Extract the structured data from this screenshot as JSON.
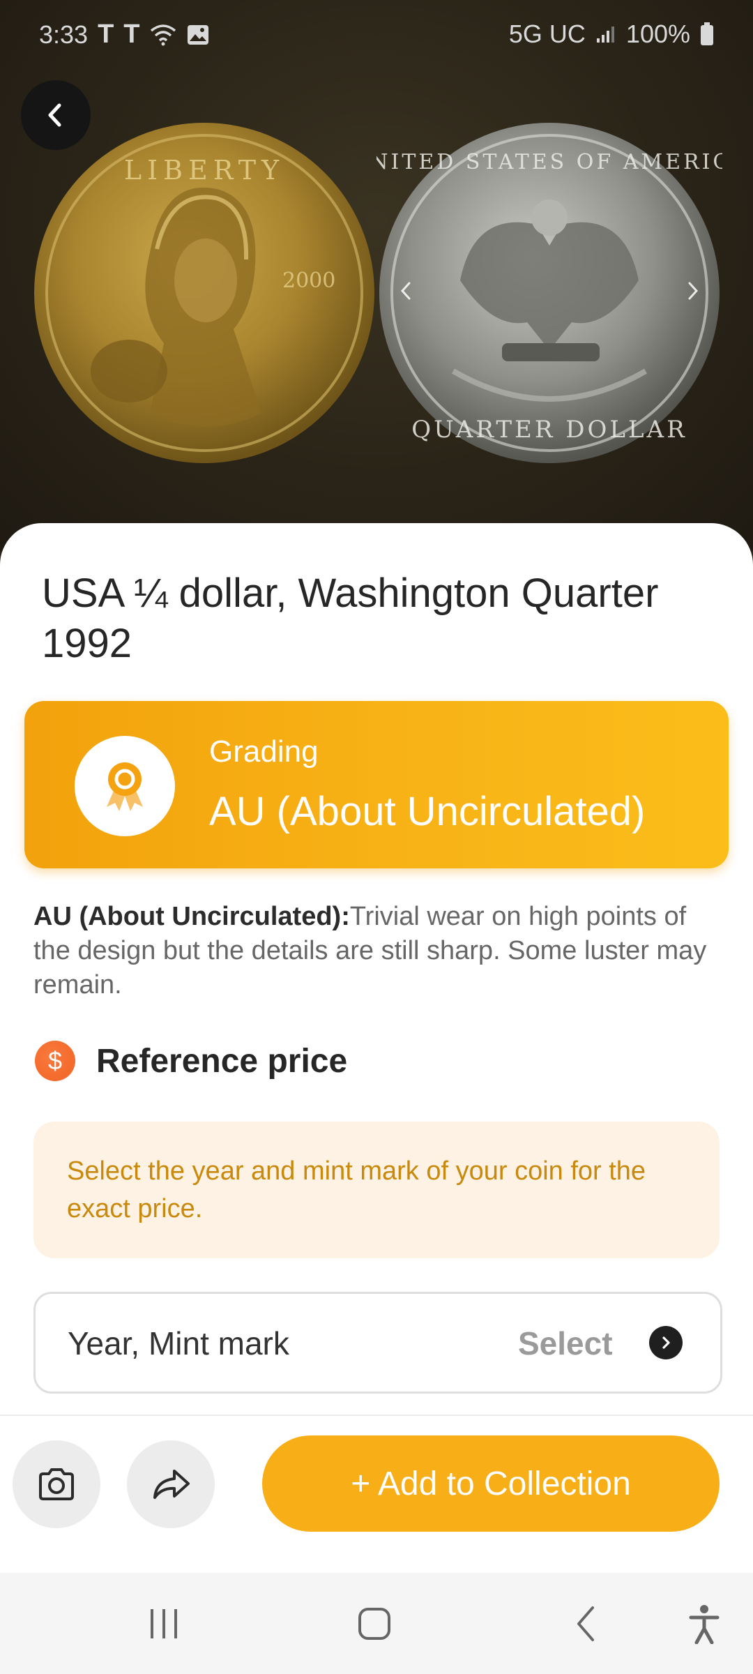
{
  "status_bar": {
    "time": "3:33",
    "carrier_1": "T",
    "carrier_2": "T",
    "network": "5G UC",
    "battery": "100%"
  },
  "coin": {
    "title": "USA ¼ dollar, Washington Quarter 1992",
    "images": [
      "coin-obverse-image",
      "coin-reverse-image"
    ]
  },
  "grading": {
    "label": "Grading",
    "value": "AU (About Uncirculated)",
    "desc_term": "AU (About Uncirculated):",
    "desc_text": "Trivial wear on high points of the design but the details are still sharp. Some luster may remain."
  },
  "reference_price": {
    "title": "Reference price",
    "icon_glyph": "$",
    "hint": "Select the year and mint mark of your coin for the exact price."
  },
  "year_mint": {
    "label": "Year, Mint mark",
    "action": "Select"
  },
  "actions": {
    "add_to_collection": "+ Add to Collection"
  },
  "colors": {
    "accent": "#F7AE17",
    "hint_bg": "#FEF2E4",
    "hint_text": "#C9890C",
    "price_icon": "#F36A2C"
  }
}
